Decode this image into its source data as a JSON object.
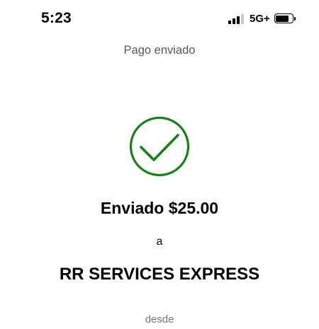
{
  "status_bar": {
    "time": "5:23",
    "network": "5G+",
    "signal_bars_active": 3,
    "signal_bars_total": 4,
    "battery_level": 0.8
  },
  "header": {
    "title": "Pago enviado"
  },
  "confirmation": {
    "icon": "checkmark-circle-icon",
    "icon_color": "#1a7f1a",
    "sent_text": "Enviado $25.00",
    "to_label": "a",
    "recipient": "RR SERVICES EXPRESS",
    "from_label": "desde"
  }
}
